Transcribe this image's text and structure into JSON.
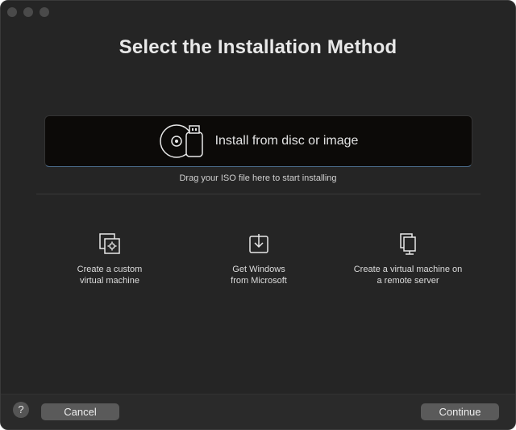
{
  "window": {
    "title": "Select the Installation Method"
  },
  "drop_zone": {
    "label": "Install from disc or image",
    "icon": "disc-usb-icon",
    "hint": "Drag your ISO file here to start installing"
  },
  "options": [
    {
      "label": "Create a custom\nvirtual machine",
      "icon": "custom-vm-icon"
    },
    {
      "label": "Get Windows\nfrom Microsoft",
      "icon": "download-icon"
    },
    {
      "label": "Create a virtual machine on\na remote server",
      "icon": "remote-server-icon"
    }
  ],
  "footer": {
    "help": "?",
    "cancel": "Cancel",
    "continue": "Continue"
  }
}
